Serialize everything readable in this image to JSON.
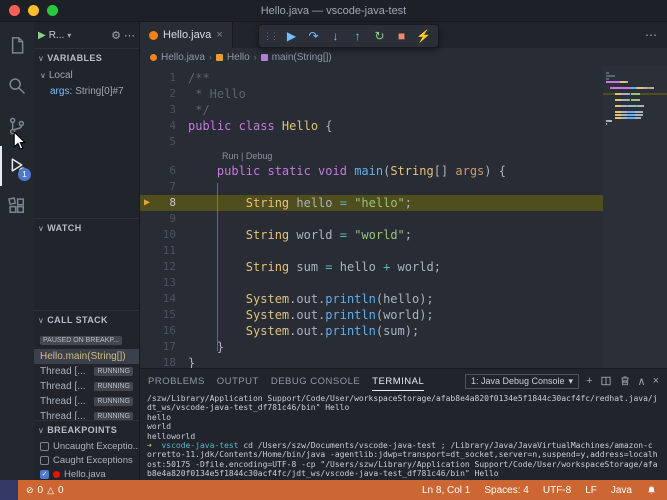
{
  "window": {
    "title": "Hello.java — vscode-java-test"
  },
  "icons": {
    "section_chevron": "∨",
    "play": "▶",
    "dropdown_chevron": "▾",
    "gear": "⚙",
    "more": "⋯",
    "close": "×",
    "drag_dots": "⋮⋮",
    "continue": "▶",
    "step_over": "↷",
    "step_into": "↓",
    "step_out": "↑",
    "restart": "↻",
    "stop": "■",
    "hot_code_replace": "⚡",
    "plus": "+",
    "chevron_up": "∧",
    "breadcrumb_sep": "›",
    "error": "⊘",
    "warning": "△",
    "check": "✓",
    "current_line_arrow": "▶"
  },
  "activity_bar": {
    "debug_badge": "1"
  },
  "sidebar": {
    "toolbar": {
      "config_label": "R..."
    },
    "variables": {
      "title": "VARIABLES",
      "scope_label": "Local",
      "entries": [
        {
          "name": "args:",
          "value": "String[0]#7"
        }
      ]
    },
    "watch": {
      "title": "WATCH"
    },
    "call_stack": {
      "title": "CALL STACK",
      "status_badge": "PAUSED ON BREAKP...",
      "frames": [
        {
          "label": "Hello.main(String[])",
          "selected": true
        },
        {
          "label": "Thread [...",
          "badge": "RUNNING"
        },
        {
          "label": "Thread [...",
          "badge": "RUNNING"
        },
        {
          "label": "Thread [...",
          "badge": "RUNNING"
        },
        {
          "label": "Thread [...",
          "badge": "RUNNING"
        }
      ]
    },
    "breakpoints": {
      "title": "BREAKPOINTS",
      "items": [
        {
          "label": "Uncaught Exceptio...",
          "checked": false,
          "dot": false
        },
        {
          "label": "Caught Exceptions",
          "checked": false,
          "dot": false
        },
        {
          "label": "Hello.java",
          "checked": true,
          "dot": true
        }
      ]
    }
  },
  "editor": {
    "tab": {
      "label": "Hello.java"
    },
    "breadcrumbs": [
      {
        "label": "Hello.java"
      },
      {
        "label": "Hello"
      },
      {
        "label": "main(String[])"
      }
    ],
    "token_colors": {
      "cm": "#5c6370",
      "kw": "#c678dd",
      "cl": "#e5c07b",
      "fn": "#61afef",
      "st": "#98c379",
      "pm": "#d19a66",
      "op": "#56b6c2",
      "pl": "#abb2bf"
    },
    "code": {
      "lines": [
        {
          "n": 1,
          "tokens": [
            {
              "t": "/**",
              "c": "cm"
            }
          ]
        },
        {
          "n": 2,
          "tokens": [
            {
              "t": " * Hello",
              "c": "cm"
            }
          ]
        },
        {
          "n": 3,
          "tokens": [
            {
              "t": " */",
              "c": "cm"
            }
          ]
        },
        {
          "n": 4,
          "tokens": [
            {
              "t": "public class ",
              "c": "kw"
            },
            {
              "t": "Hello",
              "c": "cl"
            },
            {
              "t": " {",
              "c": "pl"
            }
          ]
        },
        {
          "n": 5,
          "tokens": []
        },
        {
          "n": 6,
          "codelens": "Run | Debug",
          "tokens": [
            {
              "t": "    ",
              "c": "pl"
            },
            {
              "t": "public static void ",
              "c": "kw"
            },
            {
              "t": "main",
              "c": "fn"
            },
            {
              "t": "(",
              "c": "pl"
            },
            {
              "t": "String",
              "c": "cl"
            },
            {
              "t": "[] ",
              "c": "pl"
            },
            {
              "t": "args",
              "c": "pm"
            },
            {
              "t": ") {",
              "c": "pl"
            }
          ]
        },
        {
          "n": 7,
          "tokens": []
        },
        {
          "n": 8,
          "current": true,
          "tokens": [
            {
              "t": "        ",
              "c": "pl"
            },
            {
              "t": "String",
              "c": "cl"
            },
            {
              "t": " hello ",
              "c": "pl"
            },
            {
              "t": "=",
              "c": "op"
            },
            {
              "t": " ",
              "c": "pl"
            },
            {
              "t": "\"hello\"",
              "c": "st"
            },
            {
              "t": ";",
              "c": "pl"
            }
          ]
        },
        {
          "n": 9,
          "tokens": []
        },
        {
          "n": 10,
          "tokens": [
            {
              "t": "        ",
              "c": "pl"
            },
            {
              "t": "String",
              "c": "cl"
            },
            {
              "t": " world ",
              "c": "pl"
            },
            {
              "t": "=",
              "c": "op"
            },
            {
              "t": " ",
              "c": "pl"
            },
            {
              "t": "\"world\"",
              "c": "st"
            },
            {
              "t": ";",
              "c": "pl"
            }
          ]
        },
        {
          "n": 11,
          "tokens": []
        },
        {
          "n": 12,
          "tokens": [
            {
              "t": "        ",
              "c": "pl"
            },
            {
              "t": "String",
              "c": "cl"
            },
            {
              "t": " sum ",
              "c": "pl"
            },
            {
              "t": "=",
              "c": "op"
            },
            {
              "t": " hello ",
              "c": "pl"
            },
            {
              "t": "+",
              "c": "op"
            },
            {
              "t": " world",
              "c": "pl"
            },
            {
              "t": ";",
              "c": "pl"
            }
          ]
        },
        {
          "n": 13,
          "tokens": []
        },
        {
          "n": 14,
          "tokens": [
            {
              "t": "        ",
              "c": "pl"
            },
            {
              "t": "System",
              "c": "cl"
            },
            {
              "t": ".out.",
              "c": "pl"
            },
            {
              "t": "println",
              "c": "fn"
            },
            {
              "t": "(hello);",
              "c": "pl"
            }
          ]
        },
        {
          "n": 15,
          "tokens": [
            {
              "t": "        ",
              "c": "pl"
            },
            {
              "t": "System",
              "c": "cl"
            },
            {
              "t": ".out.",
              "c": "pl"
            },
            {
              "t": "println",
              "c": "fn"
            },
            {
              "t": "(world);",
              "c": "pl"
            }
          ]
        },
        {
          "n": 16,
          "tokens": [
            {
              "t": "        ",
              "c": "pl"
            },
            {
              "t": "System",
              "c": "cl"
            },
            {
              "t": ".out.",
              "c": "pl"
            },
            {
              "t": "println",
              "c": "fn"
            },
            {
              "t": "(sum);",
              "c": "pl"
            }
          ]
        },
        {
          "n": 17,
          "tokens": [
            {
              "t": "    }",
              "c": "pl"
            }
          ]
        },
        {
          "n": 18,
          "tokens": [
            {
              "t": "}",
              "c": "pl"
            }
          ]
        }
      ]
    }
  },
  "panel": {
    "tabs": [
      {
        "label": "PROBLEMS"
      },
      {
        "label": "OUTPUT"
      },
      {
        "label": "DEBUG CONSOLE"
      },
      {
        "label": "TERMINAL"
      }
    ],
    "console_selector": "1: Java Debug Console",
    "terminal": {
      "prompt_arrow": "➜",
      "lines": [
        [
          {
            "t": "/szw/Library/Application Support/Code/User/workspaceStorage/afab8e4a820f0134e5f1844c30acf4fc/redhat.java/j",
            "c": "out"
          }
        ],
        [
          {
            "t": "dt_ws/vscode-java-test_df781c46/bin\" Hello",
            "c": "out"
          }
        ],
        [
          {
            "t": "hello",
            "c": "out"
          }
        ],
        [
          {
            "t": "world",
            "c": "out"
          }
        ],
        [
          {
            "t": "helloworld",
            "c": "out"
          }
        ],
        [
          {
            "t": "➜  ",
            "c": "green"
          },
          {
            "t": "vscode-java-test",
            "c": "cyan"
          },
          {
            "t": " cd /Users/szw/Documents/vscode-java-test ; /Library/Java/JavaVirtualMachines/amazon-c",
            "c": "out"
          }
        ],
        [
          {
            "t": "orretto-11.jdk/Contents/Home/bin/java -agentlib:jdwp=transport=dt_socket,server=n,suspend=y,address=localh",
            "c": "out"
          }
        ],
        [
          {
            "t": "ost:50175 -Dfile.encoding=UTF-8 -cp \"/Users/szw/Library/Application Support/Code/User/workspaceStorage/afa",
            "c": "out"
          }
        ],
        [
          {
            "t": "b8e4a820f0134e5f1844c30acf4fc/jdt_ws/vscode-java-test_df781c46/bin\" Hello",
            "c": "out"
          }
        ]
      ]
    }
  },
  "status_bar": {
    "errors": "0",
    "warnings": "0",
    "right": [
      "Ln 8, Col 1",
      "Spaces: 4",
      "UTF-8",
      "LF",
      "Java"
    ]
  }
}
